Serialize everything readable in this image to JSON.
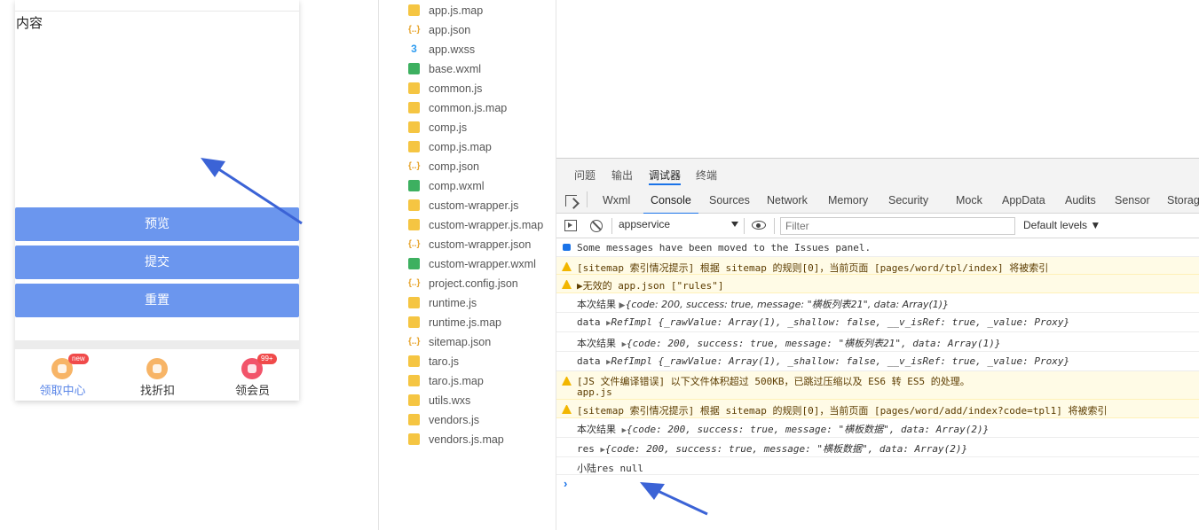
{
  "phone": {
    "content_text": "内容",
    "buttons": {
      "preview": "预览",
      "submit": "提交",
      "reset": "重置"
    },
    "tabbar": [
      {
        "label": "领取中心",
        "badge": "new",
        "active": true
      },
      {
        "label": "找折扣",
        "badge": "",
        "active": false
      },
      {
        "label": "领会员",
        "badge": "99+",
        "active": false
      }
    ]
  },
  "files": [
    {
      "name": "app.js.map",
      "type": "js"
    },
    {
      "name": "app.json",
      "type": "json"
    },
    {
      "name": "app.wxss",
      "type": "wxss"
    },
    {
      "name": "base.wxml",
      "type": "wxml"
    },
    {
      "name": "common.js",
      "type": "js"
    },
    {
      "name": "common.js.map",
      "type": "js"
    },
    {
      "name": "comp.js",
      "type": "js"
    },
    {
      "name": "comp.js.map",
      "type": "js"
    },
    {
      "name": "comp.json",
      "type": "json"
    },
    {
      "name": "comp.wxml",
      "type": "wxml"
    },
    {
      "name": "custom-wrapper.js",
      "type": "js"
    },
    {
      "name": "custom-wrapper.js.map",
      "type": "js"
    },
    {
      "name": "custom-wrapper.json",
      "type": "json"
    },
    {
      "name": "custom-wrapper.wxml",
      "type": "wxml"
    },
    {
      "name": "project.config.json",
      "type": "json"
    },
    {
      "name": "runtime.js",
      "type": "js"
    },
    {
      "name": "runtime.js.map",
      "type": "js"
    },
    {
      "name": "sitemap.json",
      "type": "json"
    },
    {
      "name": "taro.js",
      "type": "js"
    },
    {
      "name": "taro.js.map",
      "type": "js"
    },
    {
      "name": "utils.wxs",
      "type": "js"
    },
    {
      "name": "vendors.js",
      "type": "js"
    },
    {
      "name": "vendors.js.map",
      "type": "js"
    }
  ],
  "devtools": {
    "top_tabs": [
      "问题",
      "输出",
      "调试器",
      "终端"
    ],
    "active_top_tab": "调试器",
    "panel_tabs": [
      "Wxml",
      "Console",
      "Sources",
      "Network",
      "Memory",
      "Security",
      "Mock",
      "AppData",
      "Audits",
      "Sensor",
      "Storage"
    ],
    "active_panel_tab": "Console",
    "context": "appservice",
    "filter_placeholder": "Filter",
    "levels": "Default levels ▼"
  },
  "console": {
    "info_moved": "Some messages have been moved to the Issues panel.",
    "warn_sitemap1": "[sitemap 索引情况提示] 根据 sitemap 的规则[0]，当前页面 [pages/word/tpl/index] 将被索引",
    "warn_invalid": "▶无效的 app.json [\"rules\"]",
    "log1_label": "本次结果",
    "log1_obj": "{code: 200, success: true, message: \"横板列表21\", data: Array(1)}",
    "log2_label": "data",
    "log2_obj": "RefImpl {_rawValue: Array(1), _shallow: false, __v_isRef: true, _value: Proxy}",
    "log3_label": "本次结果",
    "log3_obj": "{code: 200, success: true, message: \"横板列表21\", data: Array(1)}",
    "log4_label": "data",
    "log4_obj": "RefImpl {_rawValue: Array(1), _shallow: false, __v_isRef: true, _value: Proxy}",
    "warn_compile_line1": "[JS 文件编译错误] 以下文件体积超过 500KB，已跳过压缩以及 ES6 转 ES5 的处理。",
    "warn_compile_line2": "app.js",
    "warn_sitemap2": "[sitemap 索引情况提示] 根据 sitemap 的规则[0]，当前页面 [pages/word/add/index?code=tpl1] 将被索引",
    "log5_label": "本次结果",
    "log5_obj": "{code: 200, success: true, message: \"横板数据\", data: Array(2)}",
    "log6_label": "res",
    "log6_obj": "{code: 200, success: true, message: \"横板数据\", data: Array(2)}",
    "log7": "小陆res null",
    "prompt": "›"
  }
}
